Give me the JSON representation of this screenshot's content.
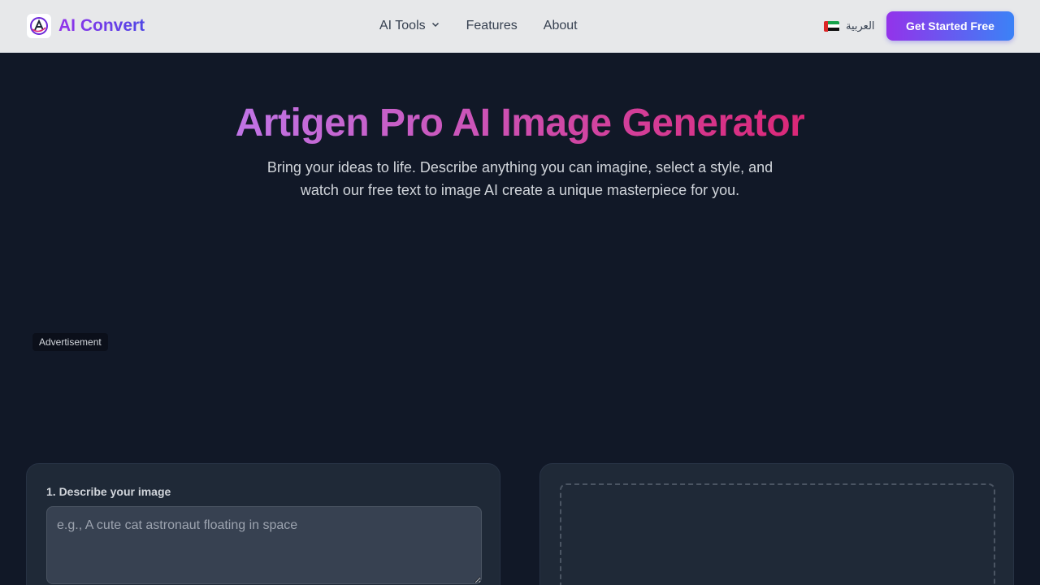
{
  "header": {
    "brand_name": "AI Convert",
    "logo_icon": "ai-convert-logo-icon",
    "nav": {
      "ai_tools": "AI Tools",
      "features": "Features",
      "about": "About"
    },
    "language": "العربية",
    "cta": "Get Started Free"
  },
  "hero": {
    "title": "Artigen Pro AI Image Generator",
    "subtitle_line1": "Bring your ideas to life. Describe anything you can imagine, select a style, and",
    "subtitle_line2": "watch our free text to image AI create a unique masterpiece for you."
  },
  "ad": {
    "label": "Advertisement"
  },
  "form": {
    "describe_label": "1. Describe your image",
    "prompt_placeholder": "e.g., A cute cat astronaut floating in space"
  },
  "colors": {
    "page_bg": "#111827",
    "header_bg": "#e7e8ea",
    "card_bg": "#1f2937",
    "accent_start": "#9333ea",
    "accent_end": "#3b82f6",
    "title_gradient_start": "#c074e6",
    "title_gradient_end": "#db2777"
  }
}
